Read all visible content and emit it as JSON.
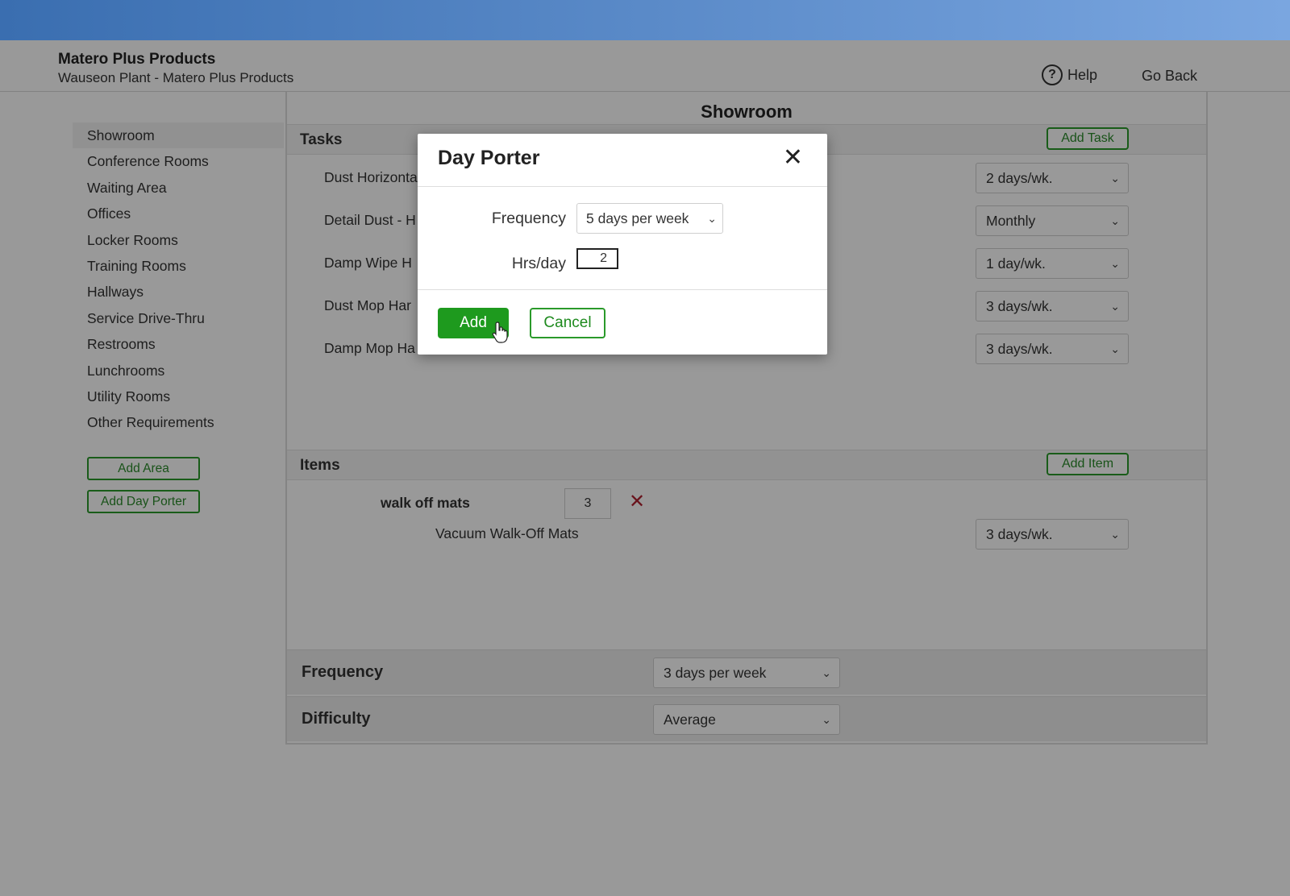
{
  "header": {
    "company": "Matero Plus Products",
    "plant": "Wauseon Plant - Matero Plus Products",
    "help_label": "Help",
    "help_icon": "?",
    "go_back_label": "Go Back"
  },
  "sidebar": {
    "items": [
      {
        "label": "Showroom"
      },
      {
        "label": "Conference Rooms"
      },
      {
        "label": "Waiting Area"
      },
      {
        "label": "Offices"
      },
      {
        "label": "Locker Rooms"
      },
      {
        "label": "Training Rooms"
      },
      {
        "label": "Hallways"
      },
      {
        "label": "Service Drive-Thru"
      },
      {
        "label": "Restrooms"
      },
      {
        "label": "Lunchrooms"
      },
      {
        "label": "Utility Rooms"
      },
      {
        "label": "Other Requirements"
      }
    ],
    "add_area_label": "Add Area",
    "add_day_porter_label": "Add Day Porter"
  },
  "main": {
    "title": "Showroom",
    "tasks": {
      "title": "Tasks",
      "add_label": "Add Task",
      "rows": [
        {
          "label": "Dust Horizonta",
          "frequency": "2 days/wk."
        },
        {
          "label": "Detail Dust - H",
          "frequency": "Monthly"
        },
        {
          "label": "Damp Wipe H",
          "frequency": "1 day/wk."
        },
        {
          "label": "Dust Mop Har",
          "frequency": "3 days/wk."
        },
        {
          "label": "Damp Mop Ha",
          "frequency": "3 days/wk."
        }
      ]
    },
    "items": {
      "title": "Items",
      "add_label": "Add Item",
      "item_name": "walk off mats",
      "quantity": "3",
      "remove_icon": "✕",
      "item_task": "Vacuum Walk-Off Mats",
      "item_task_frequency": "3 days/wk."
    },
    "frequency": {
      "label": "Frequency",
      "value": "3 days per week"
    },
    "difficulty": {
      "label": "Difficulty",
      "value": "Average"
    }
  },
  "modal": {
    "title": "Day Porter",
    "close_icon": "✕",
    "frequency_label": "Frequency",
    "frequency_value": "5 days per week",
    "hrs_label": "Hrs/day",
    "hrs_value": "2",
    "add_label": "Add",
    "cancel_label": "Cancel"
  },
  "colors": {
    "accent_green": "#1e9a1e",
    "topbar_start": "#3a6eb0",
    "remove_red": "#b02030"
  }
}
